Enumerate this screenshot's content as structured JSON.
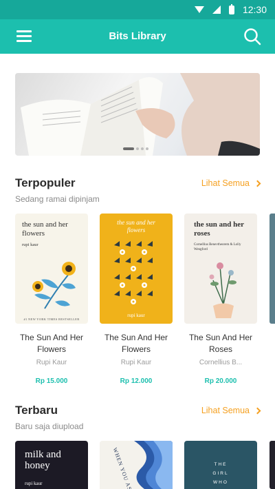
{
  "status_bar": {
    "time": "12:30"
  },
  "app_bar": {
    "title": "Bits Library"
  },
  "sections": {
    "popular": {
      "title": "Terpopuler",
      "subtitle": "Sedang ramai dipinjam",
      "see_all": "Lihat Semua",
      "books": [
        {
          "title": "The Sun And Her Flowers",
          "author": "Rupi Kaur",
          "price": "Rp 15.000",
          "cover_title": "the sun and her flowers",
          "cover_author": "rupi kaur",
          "cover_note": "#1 NEW YORK TIMES BESTSELLER"
        },
        {
          "title": "The Sun And Her Flowers",
          "author": "Rupi Kaur",
          "price": "Rp 12.000",
          "cover_title": "the sun and her flowers",
          "cover_author": "rupi kaur"
        },
        {
          "title": "The Sun And Her Roses",
          "author": "Cornellius B...",
          "price": "Rp 20.000",
          "cover_title": "the sun and her roses",
          "cover_author": "Cornellius Benevtheorem & Lolly Wengford"
        }
      ]
    },
    "newest": {
      "title": "Terbaru",
      "subtitle": "Baru saja diupload",
      "see_all": "Lihat Semua",
      "books": [
        {
          "cover_title": "milk and honey",
          "cover_author": "rupi kaur"
        },
        {
          "cover_title": "WHEN YOU ASK"
        },
        {
          "cover_title": "THE GIRL WHO FELL"
        }
      ]
    }
  },
  "colors": {
    "primary": "#1cbfae",
    "status": "#16a89a",
    "accent": "#f5a020"
  }
}
